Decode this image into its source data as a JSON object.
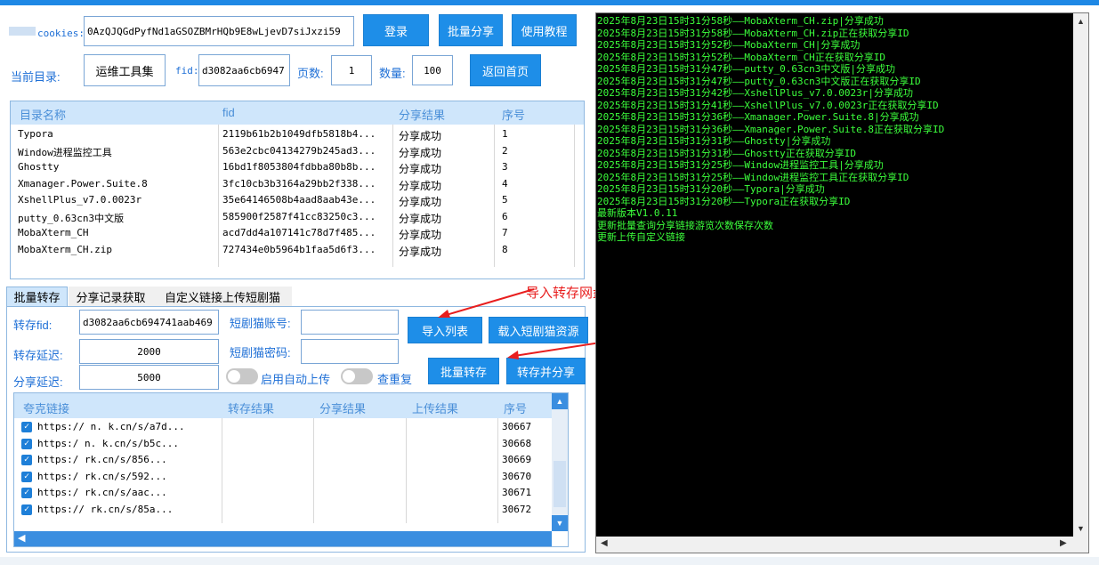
{
  "cookies": {
    "label": "cookies:",
    "value": "0AzQJQGdPyfNd1aGSOZBMrHQb9E8wLjevD7siJxzi59"
  },
  "buttons": {
    "login": "登录",
    "batch_share": "批量分享",
    "tutorial": "使用教程",
    "home": "返回首页",
    "import_list": "导入列表",
    "load_resource": "载入短剧猫资源",
    "batch_transfer": "批量转存",
    "transfer_share": "转存并分享"
  },
  "dir": {
    "label": "当前目录:",
    "value": "运维工具集",
    "fid_label": "fid:",
    "fid_value": "d3082aa6cb6947",
    "page_label": "页数:",
    "page_value": "1",
    "count_label": "数量:",
    "count_value": "100"
  },
  "top_table": {
    "headers": [
      "目录名称",
      "fid",
      "分享结果",
      "序号"
    ],
    "rows": [
      [
        "Typora",
        "2119b61b2b1049dfb5818b4...",
        "分享成功",
        "1"
      ],
      [
        "Window进程监控工具",
        "563e2cbc04134279b245ad3...",
        "分享成功",
        "2"
      ],
      [
        "Ghostty",
        "16bd1f8053804fdbba80b8b...",
        "分享成功",
        "3"
      ],
      [
        "Xmanager.Power.Suite.8",
        "3fc10cb3b3164a29bb2f338...",
        "分享成功",
        "4"
      ],
      [
        "XshellPlus_v7.0.0023r",
        "35e64146508b4aad8aab43e...",
        "分享成功",
        "5"
      ],
      [
        "putty_0.63cn3中文版",
        "585900f2587f41cc83250c3...",
        "分享成功",
        "6"
      ],
      [
        "MobaXterm_CH",
        "acd7dd4a107141c78d7f485...",
        "分享成功",
        "7"
      ],
      [
        "MobaXterm_CH.zip",
        "727434e0b5964b1faa5d6f3...",
        "分享成功",
        "8"
      ]
    ]
  },
  "tabs": [
    "批量转存",
    "分享记录获取",
    "自定义链接上传短剧猫"
  ],
  "form": {
    "fid_label": "转存fid:",
    "fid_value": "d3082aa6cb694741aab469",
    "delay_label": "转存延迟:",
    "delay_value": "2000",
    "share_delay_label": "分享延迟:",
    "share_delay_value": "5000",
    "account_label": "短剧猫账号:",
    "password_label": "短剧猫密码:",
    "auto_upload": "启用自动上传",
    "check_dup": "查重复"
  },
  "link_table": {
    "headers": [
      "夸克链接",
      "转存结果",
      "分享结果",
      "上传结果",
      "序号"
    ],
    "rows": [
      [
        "https://   n.    k.cn/s/a7d...",
        "",
        "",
        "",
        "30667"
      ],
      [
        "https:/    n.    k.cn/s/b5c...",
        "",
        "",
        "",
        "30668"
      ],
      [
        "https:/         rk.cn/s/856...",
        "",
        "",
        "",
        "30669"
      ],
      [
        "https:/         rk.cn/s/592...",
        "",
        "",
        "",
        "30670"
      ],
      [
        "https:/         rk.cn/s/aac...",
        "",
        "",
        "",
        "30671"
      ],
      [
        "https://        rk.cn/s/85a...",
        "",
        "",
        "",
        "30672"
      ]
    ]
  },
  "annotation": "导入转存网盘链接列表，导入后，在点击批量转存 或者 转存并分享",
  "console_lines": [
    "2025年8月23日15时31分58秒——MobaXterm_CH.zip|分享成功",
    "2025年8月23日15时31分58秒——MobaXterm_CH.zip正在获取分享ID",
    "2025年8月23日15时31分52秒——MobaXterm_CH|分享成功",
    "2025年8月23日15时31分52秒——MobaXterm_CH正在获取分享ID",
    "2025年8月23日15时31分47秒——putty_0.63cn3中文版|分享成功",
    "2025年8月23日15时31分47秒——putty_0.63cn3中文版正在获取分享ID",
    "2025年8月23日15时31分42秒——XshellPlus_v7.0.0023r|分享成功",
    "2025年8月23日15时31分41秒——XshellPlus_v7.0.0023r正在获取分享ID",
    "2025年8月23日15时31分36秒——Xmanager.Power.Suite.8|分享成功",
    "2025年8月23日15时31分36秒——Xmanager.Power.Suite.8正在获取分享ID",
    "2025年8月23日15时31分31秒——Ghostty|分享成功",
    "2025年8月23日15时31分31秒——Ghostty正在获取分享ID",
    "2025年8月23日15时31分25秒——Window进程监控工具|分享成功",
    "2025年8月23日15时31分25秒——Window进程监控工具正在获取分享ID",
    "2025年8月23日15时31分20秒——Typora|分享成功",
    "2025年8月23日15时31分20秒——Typora正在获取分享ID",
    "最新版本V1.0.11",
    "更新批量查询分享链接游览次数保存次数",
    "更新上传自定义链接"
  ]
}
